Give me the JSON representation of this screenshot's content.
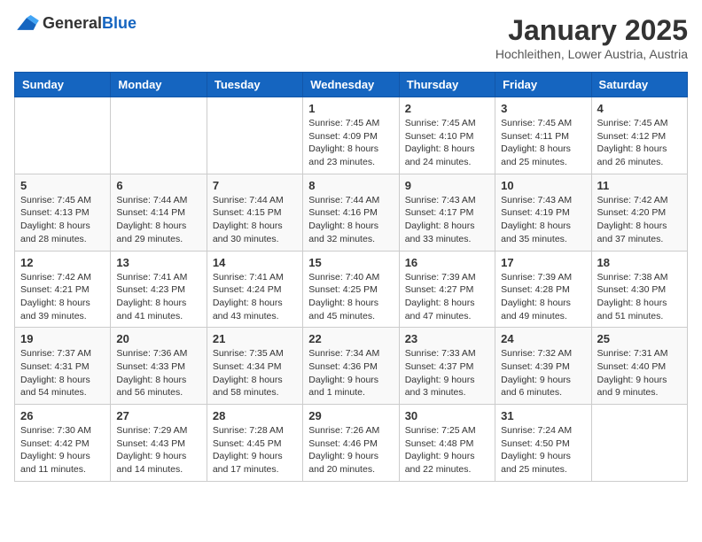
{
  "header": {
    "logo_general": "General",
    "logo_blue": "Blue",
    "month_title": "January 2025",
    "location": "Hochleithen, Lower Austria, Austria"
  },
  "days_of_week": [
    "Sunday",
    "Monday",
    "Tuesday",
    "Wednesday",
    "Thursday",
    "Friday",
    "Saturday"
  ],
  "weeks": [
    [
      {
        "day": "",
        "info": ""
      },
      {
        "day": "",
        "info": ""
      },
      {
        "day": "",
        "info": ""
      },
      {
        "day": "1",
        "info": "Sunrise: 7:45 AM\nSunset: 4:09 PM\nDaylight: 8 hours and 23 minutes."
      },
      {
        "day": "2",
        "info": "Sunrise: 7:45 AM\nSunset: 4:10 PM\nDaylight: 8 hours and 24 minutes."
      },
      {
        "day": "3",
        "info": "Sunrise: 7:45 AM\nSunset: 4:11 PM\nDaylight: 8 hours and 25 minutes."
      },
      {
        "day": "4",
        "info": "Sunrise: 7:45 AM\nSunset: 4:12 PM\nDaylight: 8 hours and 26 minutes."
      }
    ],
    [
      {
        "day": "5",
        "info": "Sunrise: 7:45 AM\nSunset: 4:13 PM\nDaylight: 8 hours and 28 minutes."
      },
      {
        "day": "6",
        "info": "Sunrise: 7:44 AM\nSunset: 4:14 PM\nDaylight: 8 hours and 29 minutes."
      },
      {
        "day": "7",
        "info": "Sunrise: 7:44 AM\nSunset: 4:15 PM\nDaylight: 8 hours and 30 minutes."
      },
      {
        "day": "8",
        "info": "Sunrise: 7:44 AM\nSunset: 4:16 PM\nDaylight: 8 hours and 32 minutes."
      },
      {
        "day": "9",
        "info": "Sunrise: 7:43 AM\nSunset: 4:17 PM\nDaylight: 8 hours and 33 minutes."
      },
      {
        "day": "10",
        "info": "Sunrise: 7:43 AM\nSunset: 4:19 PM\nDaylight: 8 hours and 35 minutes."
      },
      {
        "day": "11",
        "info": "Sunrise: 7:42 AM\nSunset: 4:20 PM\nDaylight: 8 hours and 37 minutes."
      }
    ],
    [
      {
        "day": "12",
        "info": "Sunrise: 7:42 AM\nSunset: 4:21 PM\nDaylight: 8 hours and 39 minutes."
      },
      {
        "day": "13",
        "info": "Sunrise: 7:41 AM\nSunset: 4:23 PM\nDaylight: 8 hours and 41 minutes."
      },
      {
        "day": "14",
        "info": "Sunrise: 7:41 AM\nSunset: 4:24 PM\nDaylight: 8 hours and 43 minutes."
      },
      {
        "day": "15",
        "info": "Sunrise: 7:40 AM\nSunset: 4:25 PM\nDaylight: 8 hours and 45 minutes."
      },
      {
        "day": "16",
        "info": "Sunrise: 7:39 AM\nSunset: 4:27 PM\nDaylight: 8 hours and 47 minutes."
      },
      {
        "day": "17",
        "info": "Sunrise: 7:39 AM\nSunset: 4:28 PM\nDaylight: 8 hours and 49 minutes."
      },
      {
        "day": "18",
        "info": "Sunrise: 7:38 AM\nSunset: 4:30 PM\nDaylight: 8 hours and 51 minutes."
      }
    ],
    [
      {
        "day": "19",
        "info": "Sunrise: 7:37 AM\nSunset: 4:31 PM\nDaylight: 8 hours and 54 minutes."
      },
      {
        "day": "20",
        "info": "Sunrise: 7:36 AM\nSunset: 4:33 PM\nDaylight: 8 hours and 56 minutes."
      },
      {
        "day": "21",
        "info": "Sunrise: 7:35 AM\nSunset: 4:34 PM\nDaylight: 8 hours and 58 minutes."
      },
      {
        "day": "22",
        "info": "Sunrise: 7:34 AM\nSunset: 4:36 PM\nDaylight: 9 hours and 1 minute."
      },
      {
        "day": "23",
        "info": "Sunrise: 7:33 AM\nSunset: 4:37 PM\nDaylight: 9 hours and 3 minutes."
      },
      {
        "day": "24",
        "info": "Sunrise: 7:32 AM\nSunset: 4:39 PM\nDaylight: 9 hours and 6 minutes."
      },
      {
        "day": "25",
        "info": "Sunrise: 7:31 AM\nSunset: 4:40 PM\nDaylight: 9 hours and 9 minutes."
      }
    ],
    [
      {
        "day": "26",
        "info": "Sunrise: 7:30 AM\nSunset: 4:42 PM\nDaylight: 9 hours and 11 minutes."
      },
      {
        "day": "27",
        "info": "Sunrise: 7:29 AM\nSunset: 4:43 PM\nDaylight: 9 hours and 14 minutes."
      },
      {
        "day": "28",
        "info": "Sunrise: 7:28 AM\nSunset: 4:45 PM\nDaylight: 9 hours and 17 minutes."
      },
      {
        "day": "29",
        "info": "Sunrise: 7:26 AM\nSunset: 4:46 PM\nDaylight: 9 hours and 20 minutes."
      },
      {
        "day": "30",
        "info": "Sunrise: 7:25 AM\nSunset: 4:48 PM\nDaylight: 9 hours and 22 minutes."
      },
      {
        "day": "31",
        "info": "Sunrise: 7:24 AM\nSunset: 4:50 PM\nDaylight: 9 hours and 25 minutes."
      },
      {
        "day": "",
        "info": ""
      }
    ]
  ]
}
